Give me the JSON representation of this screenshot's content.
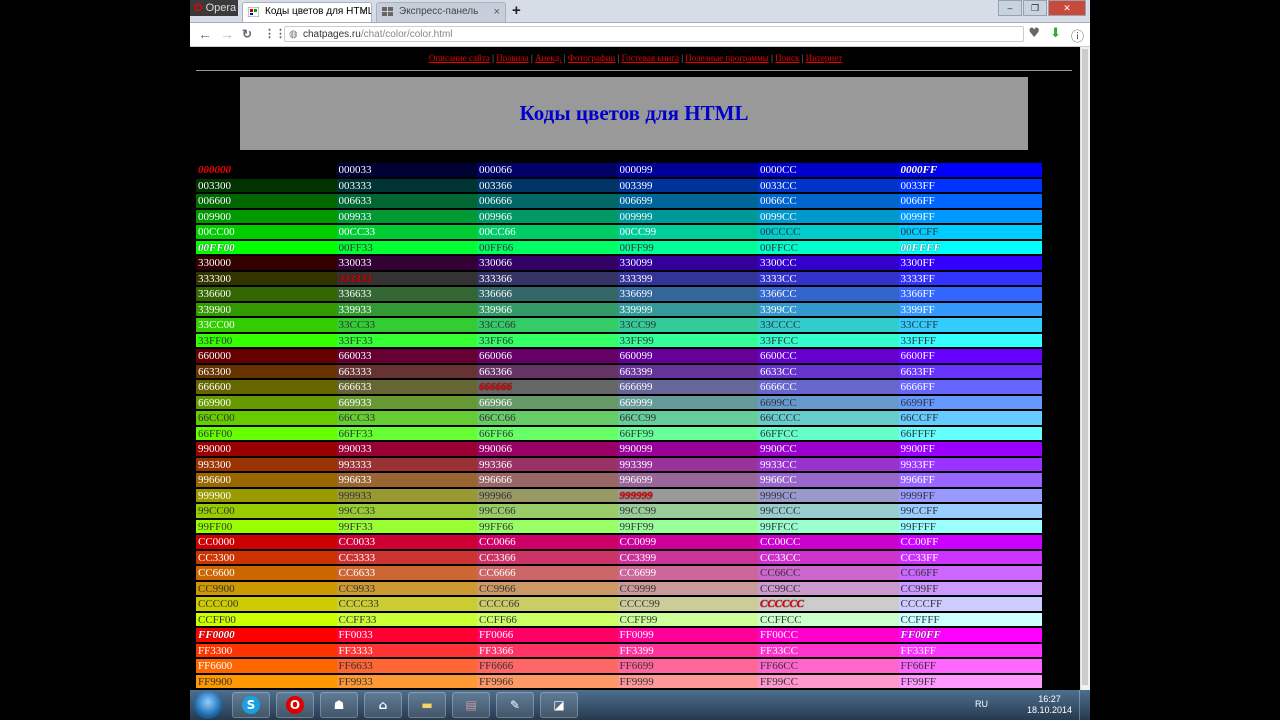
{
  "browser": {
    "opera_label": "Opera",
    "tabs": [
      {
        "label": "Коды цветов для HTML",
        "active": true
      },
      {
        "label": "Экспресс-панель",
        "active": false
      }
    ],
    "new_tab_label": "+",
    "address_domain": "chatpages.ru",
    "address_path": "/chat/color/color.html"
  },
  "page": {
    "menu": [
      "Описание сайта",
      "Правила",
      "Анекд.",
      "Фотографии",
      "Гостевая книга",
      "Полезные программы",
      "Поиск",
      "Интернет"
    ],
    "title": "Коды цветов для HTML"
  },
  "colors": {
    "accent_title": "#0000cc",
    "menu_link": "#ee0000",
    "title_box": "#999999"
  },
  "color_table": {
    "rows": [
      [
        "000000",
        "000033",
        "000066",
        "000099",
        "0000CC",
        "0000FF"
      ],
      [
        "003300",
        "003333",
        "003366",
        "003399",
        "0033CC",
        "0033FF"
      ],
      [
        "006600",
        "006633",
        "006666",
        "006699",
        "0066CC",
        "0066FF"
      ],
      [
        "009900",
        "009933",
        "009966",
        "009999",
        "0099CC",
        "0099FF"
      ],
      [
        "00CC00",
        "00CC33",
        "00CC66",
        "00CC99",
        "00CCCC",
        "00CCFF"
      ],
      [
        "00FF00",
        "00FF33",
        "00FF66",
        "00FF99",
        "00FFCC",
        "00FFFF"
      ],
      [
        "330000",
        "330033",
        "330066",
        "330099",
        "3300CC",
        "3300FF"
      ],
      [
        "333300",
        "333333",
        "333366",
        "333399",
        "3333CC",
        "3333FF"
      ],
      [
        "336600",
        "336633",
        "336666",
        "336699",
        "3366CC",
        "3366FF"
      ],
      [
        "339900",
        "339933",
        "339966",
        "339999",
        "3399CC",
        "3399FF"
      ],
      [
        "33CC00",
        "33CC33",
        "33CC66",
        "33CC99",
        "33CCCC",
        "33CCFF"
      ],
      [
        "33FF00",
        "33FF33",
        "33FF66",
        "33FF99",
        "33FFCC",
        "33FFFF"
      ],
      [
        "660000",
        "660033",
        "660066",
        "660099",
        "6600CC",
        "6600FF"
      ],
      [
        "663300",
        "663333",
        "663366",
        "663399",
        "6633CC",
        "6633FF"
      ],
      [
        "666600",
        "666633",
        "666666",
        "666699",
        "6666CC",
        "6666FF"
      ],
      [
        "669900",
        "669933",
        "669966",
        "669999",
        "6699CC",
        "6699FF"
      ],
      [
        "66CC00",
        "66CC33",
        "66CC66",
        "66CC99",
        "66CCCC",
        "66CCFF"
      ],
      [
        "66FF00",
        "66FF33",
        "66FF66",
        "66FF99",
        "66FFCC",
        "66FFFF"
      ],
      [
        "990000",
        "990033",
        "990066",
        "990099",
        "9900CC",
        "9900FF"
      ],
      [
        "993300",
        "993333",
        "993366",
        "993399",
        "9933CC",
        "9933FF"
      ],
      [
        "996600",
        "996633",
        "996666",
        "996699",
        "9966CC",
        "9966FF"
      ],
      [
        "999900",
        "999933",
        "999966",
        "999999",
        "9999CC",
        "9999FF"
      ],
      [
        "99CC00",
        "99CC33",
        "99CC66",
        "99CC99",
        "99CCCC",
        "99CCFF"
      ],
      [
        "99FF00",
        "99FF33",
        "99FF66",
        "99FF99",
        "99FFCC",
        "99FFFF"
      ],
      [
        "CC0000",
        "CC0033",
        "CC0066",
        "CC0099",
        "CC00CC",
        "CC00FF"
      ],
      [
        "CC3300",
        "CC3333",
        "CC3366",
        "CC3399",
        "CC33CC",
        "CC33FF"
      ],
      [
        "CC6600",
        "CC6633",
        "CC6666",
        "CC6699",
        "CC66CC",
        "CC66FF"
      ],
      [
        "CC9900",
        "CC9933",
        "CC9966",
        "CC9999",
        "CC99CC",
        "CC99FF"
      ],
      [
        "CCCC00",
        "CCCC33",
        "CCCC66",
        "CCCC99",
        "CCCCCC",
        "CCCCFF"
      ],
      [
        "CCFF00",
        "CCFF33",
        "CCFF66",
        "CCFF99",
        "CCFFCC",
        "CCFFFF"
      ],
      [
        "FF0000",
        "FF0033",
        "FF0066",
        "FF0099",
        "FF00CC",
        "FF00FF"
      ],
      [
        "FF3300",
        "FF3333",
        "FF3366",
        "FF3399",
        "FF33CC",
        "FF33FF"
      ],
      [
        "FF6600",
        "FF6633",
        "FF6666",
        "FF6699",
        "FF66CC",
        "FF66FF"
      ],
      [
        "FF9900",
        "FF9933",
        "FF9966",
        "FF9999",
        "FF99CC",
        "FF99FF"
      ]
    ],
    "emphasized": [
      "000000",
      "00FF00",
      "0000FF",
      "00FFFF",
      "333333",
      "666666",
      "999999",
      "CCCCCC",
      "FF0000",
      "FF00FF"
    ]
  },
  "taskbar": {
    "apps": [
      "start-orb",
      "explorer",
      "skype",
      "opera",
      "game",
      "media",
      "folder",
      "winrar",
      "notepad",
      "tool"
    ],
    "language": "RU",
    "time": "16:27",
    "date": "18.10.2014"
  }
}
